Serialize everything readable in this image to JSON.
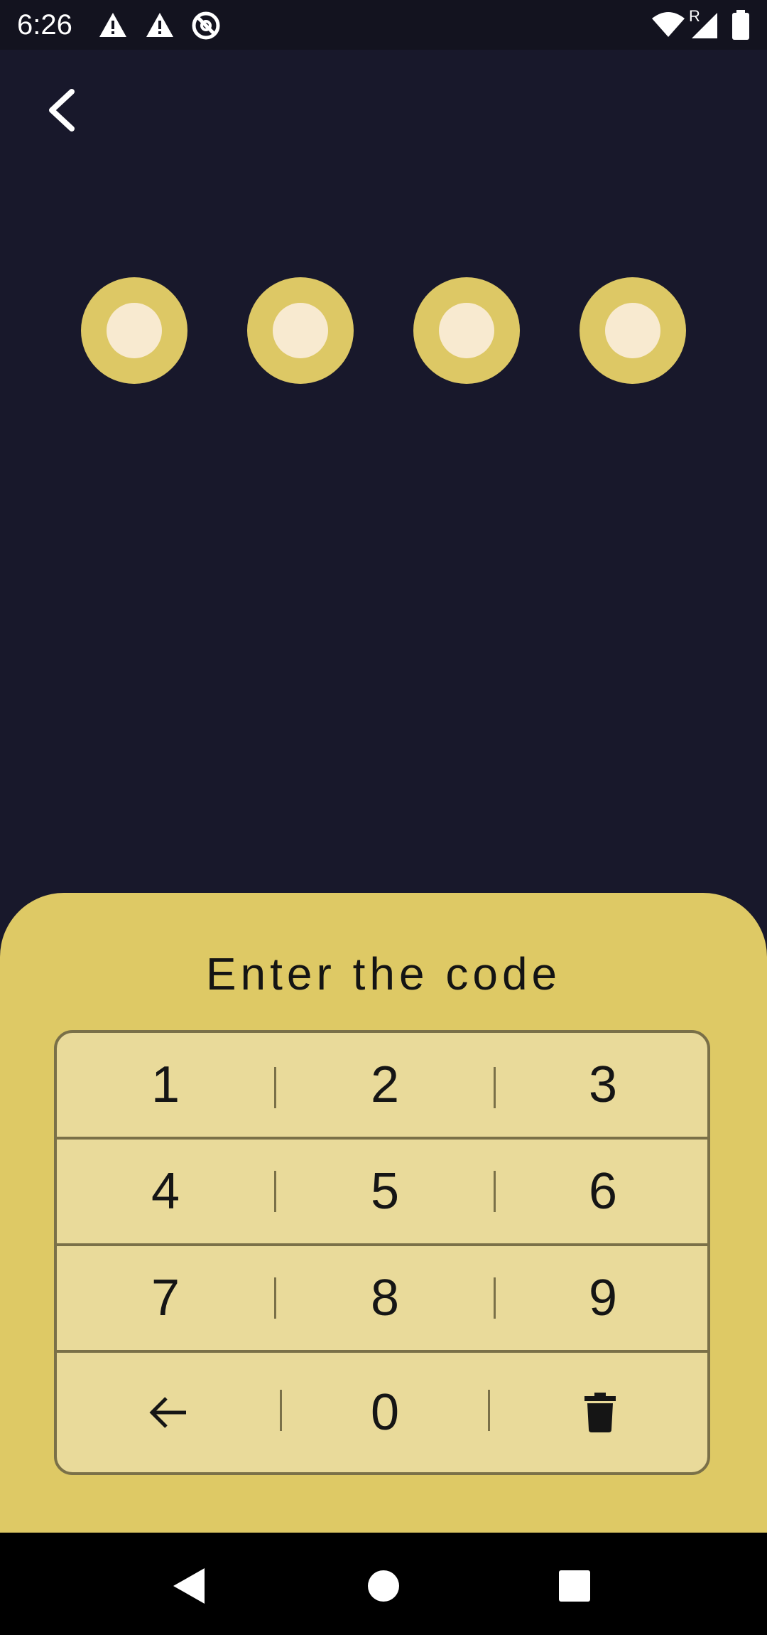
{
  "status_bar": {
    "time": "6:26",
    "icons": [
      "warning-icon",
      "warning-icon",
      "data-saver-icon",
      "wifi-icon",
      "signal-icon",
      "battery-icon"
    ],
    "roaming_label": "R"
  },
  "header": {
    "back_icon": "chevron-left-icon"
  },
  "pin": {
    "length": 4,
    "filled": 0
  },
  "sheet": {
    "title": "Enter the code"
  },
  "keypad": {
    "keys": [
      "1",
      "2",
      "3",
      "4",
      "5",
      "6",
      "7",
      "8",
      "9",
      "0"
    ],
    "backspace_icon": "arrow-left-icon",
    "clear_icon": "trash-icon"
  },
  "nav_bar": {
    "buttons": [
      "back-triangle-icon",
      "home-circle-icon",
      "recents-square-icon"
    ]
  },
  "colors": {
    "background": "#18182b",
    "accent": "#ddc865",
    "pin_center": "#f8ead0",
    "keypad_bg": "#e9da9a",
    "keypad_border": "#7a7048"
  }
}
